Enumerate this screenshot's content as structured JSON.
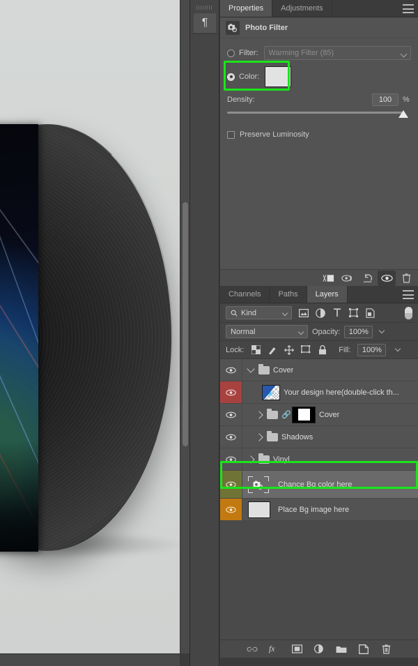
{
  "canvas": {
    "name": "vinyl-record-mockup",
    "description": "Vinyl record and album sleeve mockup on light grey background"
  },
  "mini_dock": {
    "paragraph_glyph": "¶",
    "icon": "paragraph-icon"
  },
  "properties": {
    "tabs": [
      {
        "label": "Properties",
        "active": true
      },
      {
        "label": "Adjustments",
        "active": false
      }
    ],
    "panel_menu_icon": "hamburger-menu-icon",
    "header": {
      "icon": "photo-filter-icon",
      "title": "Photo Filter"
    },
    "filter": {
      "label": "Filter:",
      "selected": false,
      "value": "Warming Filter (85)"
    },
    "color": {
      "label": "Color:",
      "selected": true,
      "swatch_hex": "#e2e2e2",
      "highlight_hex": "#1ae51a"
    },
    "density": {
      "label": "Density:",
      "value": "100",
      "unit": "%",
      "slider_percent": 100
    },
    "preserve_luminosity": {
      "label": "Preserve Luminosity",
      "checked": false
    },
    "footer_buttons": [
      {
        "name": "clip-to-layer-icon",
        "selected": false
      },
      {
        "name": "toggle-mask-view-icon",
        "selected": false
      },
      {
        "name": "reset-icon",
        "selected": false
      },
      {
        "name": "visibility-eye-icon",
        "selected": true
      },
      {
        "name": "delete-trash-icon",
        "selected": false
      }
    ]
  },
  "layers": {
    "tabs": [
      {
        "label": "Channels",
        "active": false
      },
      {
        "label": "Paths",
        "active": false
      },
      {
        "label": "Layers",
        "active": true
      }
    ],
    "panel_menu_icon": "hamburger-menu-icon",
    "filter": {
      "search_icon": "search-icon",
      "kind_label": "Kind",
      "type_filters": [
        "pixel-layer-filter-icon",
        "adjustment-layer-filter-icon",
        "type-layer-filter-icon",
        "shape-layer-filter-icon",
        "smart-object-filter-icon"
      ],
      "toggle_name": "filter-enable-toggle"
    },
    "blend": {
      "mode": "Normal",
      "opacity_label": "Opacity:",
      "opacity_value": "100%"
    },
    "lock": {
      "label": "Lock:",
      "icons": [
        "lock-transparent-pixels-icon",
        "lock-image-pixels-icon",
        "lock-position-icon",
        "lock-artboard-nesting-icon",
        "lock-all-icon"
      ],
      "fill_label": "Fill:",
      "fill_value": "100%"
    },
    "rows": [
      {
        "name": "Cover",
        "type": "group",
        "expanded": true,
        "indent": 0,
        "eye_visible": true,
        "eye_bg": "none",
        "selected": false
      },
      {
        "name": "Your design here(double-click th...",
        "type": "smart-object-thumb",
        "expanded": false,
        "indent": 1,
        "eye_visible": true,
        "eye_bg": "red",
        "selected": false
      },
      {
        "name": "Cover",
        "type": "group-masked",
        "expanded": false,
        "indent": 1,
        "eye_visible": true,
        "eye_bg": "none",
        "selected": false
      },
      {
        "name": "Shadows",
        "type": "group",
        "expanded": false,
        "indent": 1,
        "eye_visible": true,
        "eye_bg": "none",
        "selected": false
      },
      {
        "name": "Vinyl",
        "type": "group",
        "expanded": false,
        "indent": 0,
        "eye_visible": true,
        "eye_bg": "none",
        "selected": false
      },
      {
        "name": "Chance Bg color here",
        "type": "smart-object-placeholder",
        "expanded": false,
        "indent": 0,
        "eye_visible": true,
        "eye_bg": "olive",
        "selected": true,
        "highlighted": true
      },
      {
        "name": "Place Bg image here",
        "type": "plain",
        "expanded": false,
        "indent": 0,
        "eye_visible": true,
        "eye_bg": "orange",
        "selected": false
      }
    ],
    "highlight_hex": "#1ae51a",
    "footer_buttons": [
      {
        "name": "link-layers-icon",
        "label": "link"
      },
      {
        "name": "layer-styles-fx-icon",
        "label": "fx"
      },
      {
        "name": "add-layer-mask-icon",
        "label": "mask"
      },
      {
        "name": "new-adjustment-layer-icon",
        "label": "adjustment"
      },
      {
        "name": "new-group-icon",
        "label": "group"
      },
      {
        "name": "new-layer-icon",
        "label": "new-layer"
      },
      {
        "name": "delete-layer-icon",
        "label": "delete"
      }
    ]
  }
}
